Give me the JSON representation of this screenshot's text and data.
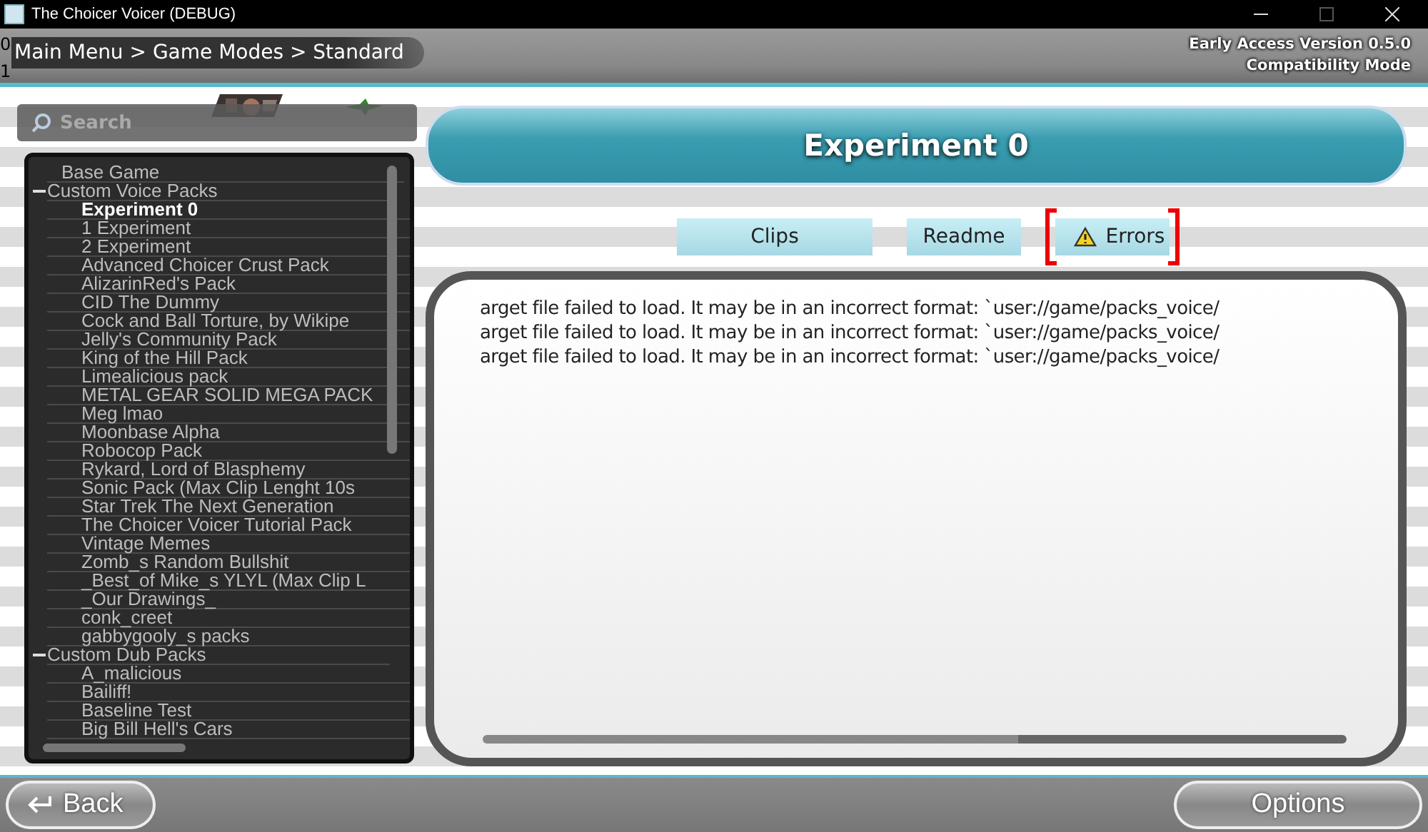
{
  "window": {
    "title": "The Choicer Voicer (DEBUG)"
  },
  "debug_labels": [
    "0",
    "1"
  ],
  "breadcrumb": "Main Menu > Game Modes > Standard",
  "version": {
    "build": "Early Access Version 0.5.0",
    "mode": "Compatibility Mode"
  },
  "search": {
    "placeholder": "Search"
  },
  "tree": [
    {
      "label": "Base Game",
      "selected": false
    },
    {
      "label": "Custom Voice Packs",
      "selected": false,
      "expanded": true,
      "children": [
        {
          "label": "Experiment 0",
          "selected": true
        },
        {
          "label": "1 Experiment",
          "selected": false
        },
        {
          "label": "2 Experiment",
          "selected": false
        },
        {
          "label": "Advanced Choicer Crust Pack",
          "selected": false
        },
        {
          "label": "AlizarinRed's Pack",
          "selected": false
        },
        {
          "label": "CID The Dummy",
          "selected": false
        },
        {
          "label": "Cock and Ball Torture, by Wikipe",
          "selected": false
        },
        {
          "label": "Jelly's Community Pack",
          "selected": false
        },
        {
          "label": "King of the Hill Pack",
          "selected": false
        },
        {
          "label": "Limealicious pack",
          "selected": false
        },
        {
          "label": "METAL GEAR SOLID MEGA PACK",
          "selected": false
        },
        {
          "label": "Meg lmao",
          "selected": false
        },
        {
          "label": "Moonbase Alpha",
          "selected": false
        },
        {
          "label": "Robocop Pack",
          "selected": false
        },
        {
          "label": "Rykard, Lord of Blasphemy",
          "selected": false
        },
        {
          "label": "Sonic Pack  (Max Clip Lenght 10s",
          "selected": false
        },
        {
          "label": "Star Trek The Next Generation",
          "selected": false
        },
        {
          "label": "The Choicer Voicer Tutorial Pack",
          "selected": false
        },
        {
          "label": "Vintage Memes",
          "selected": false
        },
        {
          "label": "Zomb_s Random Bullshit",
          "selected": false
        },
        {
          "label": "_Best_of Mike_s YLYL (Max Clip L",
          "selected": false
        },
        {
          "label": "_Our Drawings_",
          "selected": false
        },
        {
          "label": "conk_creet",
          "selected": false
        },
        {
          "label": "gabbygooly_s packs",
          "selected": false
        }
      ]
    },
    {
      "label": "Custom Dub Packs",
      "selected": false,
      "expanded": true,
      "children": [
        {
          "label": "A_malicious",
          "selected": false
        },
        {
          "label": "Bailiff!",
          "selected": false
        },
        {
          "label": "Baseline Test",
          "selected": false
        },
        {
          "label": "Big Bill Hell's Cars",
          "selected": false
        }
      ]
    }
  ],
  "pack_title": "Experiment 0",
  "tabs": [
    {
      "label": "Clips",
      "selected": false,
      "kind": "plain"
    },
    {
      "label": "Readme",
      "selected": false,
      "kind": "plain"
    },
    {
      "label": "Errors",
      "selected": true,
      "kind": "warning"
    }
  ],
  "errors": [
    "arget file failed to load. It may be in an incorrect format: `user://game/packs_voice/",
    "arget file failed to load. It may be in an incorrect format: `user://game/packs_voice/",
    "arget file failed to load. It may be in an incorrect format: `user://game/packs_voice/"
  ],
  "footer": {
    "back": "Back",
    "options": "Options"
  }
}
